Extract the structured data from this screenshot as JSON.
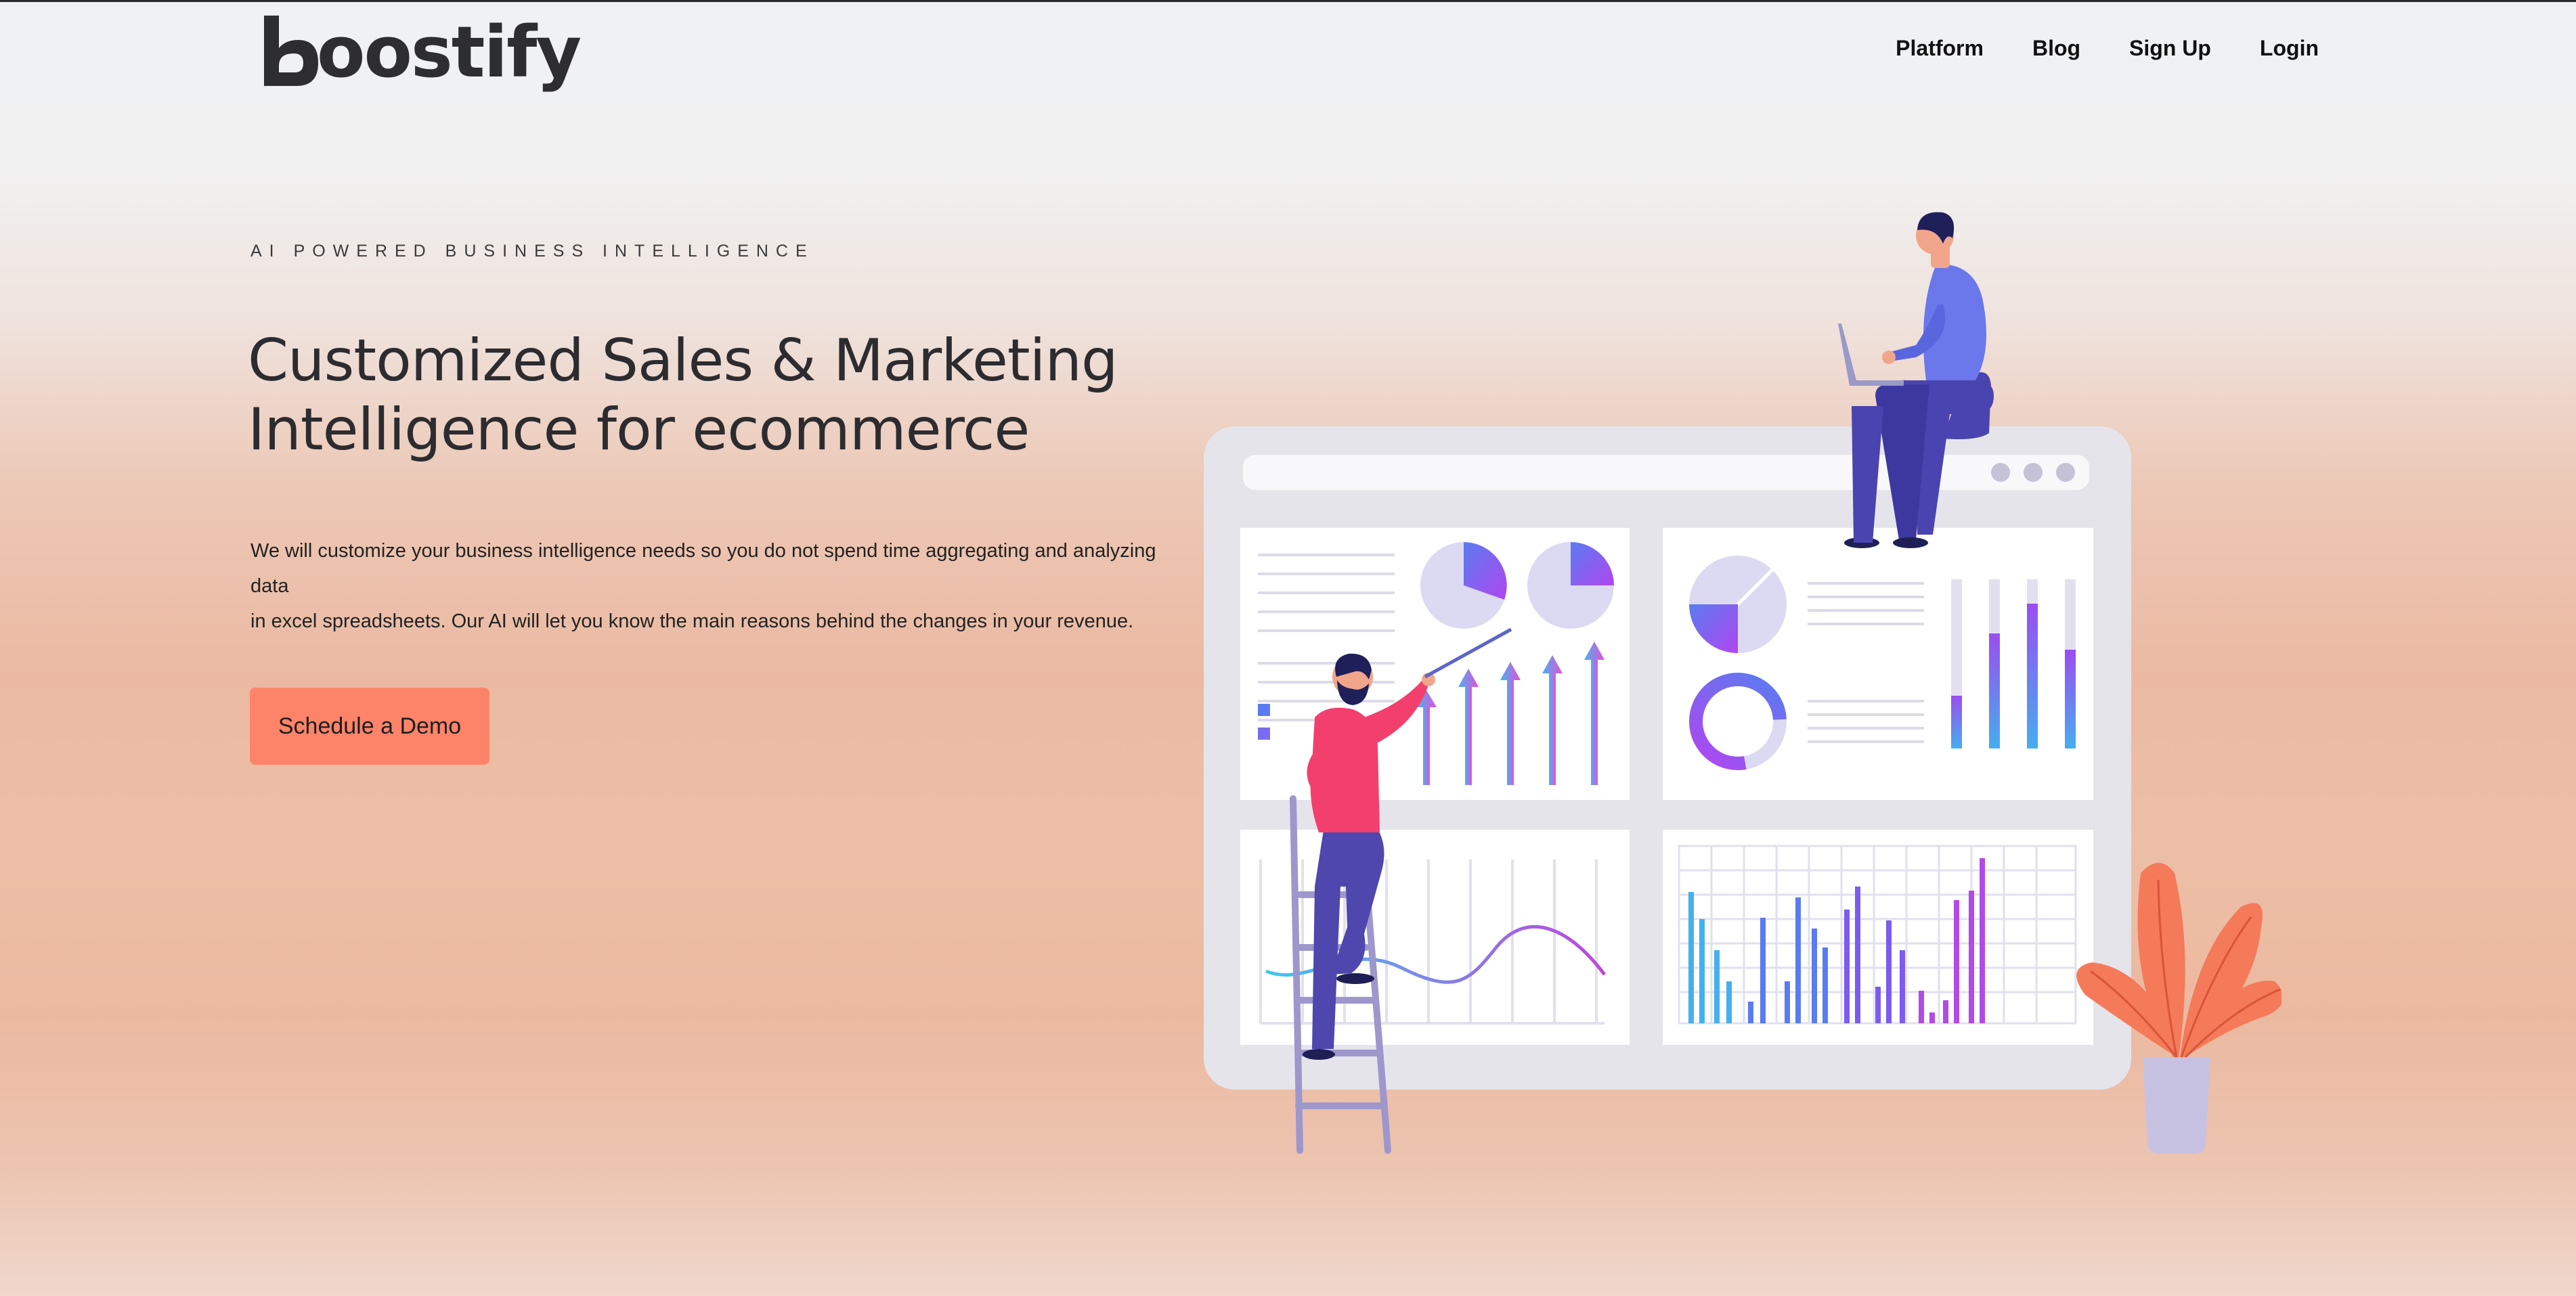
{
  "header": {
    "logo_text": "oostify",
    "nav": [
      "Platform",
      "Blog",
      "Sign Up",
      "Login"
    ]
  },
  "hero": {
    "eyebrow": "AI POWERED BUSINESS INTELLIGENCE",
    "headline_line1": "Customized Sales & Marketing",
    "headline_line2": "Intelligence for ecommerce",
    "description_line1": "We will customize your business intelligence needs so you do not spend time aggregating and analyzing data",
    "description_line2": "in excel spreadsheets. Our AI will let you know the main reasons behind the changes in your revenue.",
    "cta_label": "Schedule a Demo"
  },
  "colors": {
    "cta": "#fe8469",
    "logo": "#2d2d32",
    "accent_blue": "#5a7cf0",
    "accent_purple": "#9b4df0",
    "accent_pink": "#f04a7a"
  },
  "illustration": {
    "icons": [
      "dashboard-illustration",
      "person-with-laptop-icon",
      "person-on-ladder-icon",
      "plant-icon"
    ]
  }
}
